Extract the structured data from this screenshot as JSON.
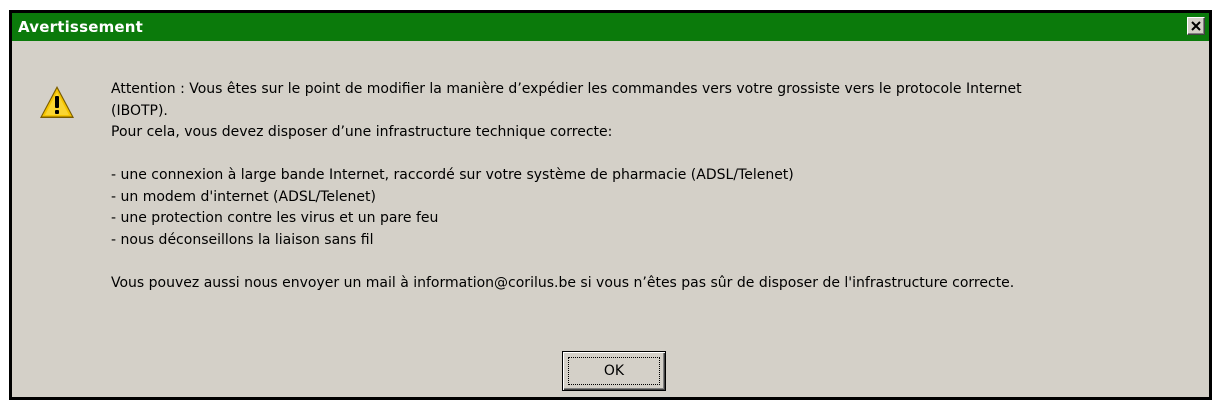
{
  "window": {
    "title": "Avertissement",
    "title_bar_color": "#0b7a0b",
    "close_icon": "close-icon"
  },
  "icon": {
    "name": "warning-icon",
    "color": "#f5c400"
  },
  "message": {
    "line1": "Attention : Vous êtes sur le point de modifier la manière d’expédier les commandes vers votre grossiste vers le protocole Internet",
    "line2": "(IBOTP).",
    "line3": "Pour cela, vous devez disposer d’une infrastructure technique correcte:",
    "items": [
      "- une connexion à large bande Internet, raccordé sur votre système de pharmacie (ADSL/Telenet)",
      "- un modem d'internet (ADSL/Telenet)",
      "- une protection contre les virus et un pare feu",
      "- nous déconseillons la liaison sans fil"
    ],
    "footer": "Vous pouvez aussi nous envoyer un mail à information@corilus.be si vous n’êtes pas sûr de disposer de l'infrastructure correcte."
  },
  "buttons": {
    "ok_label": "OK"
  }
}
